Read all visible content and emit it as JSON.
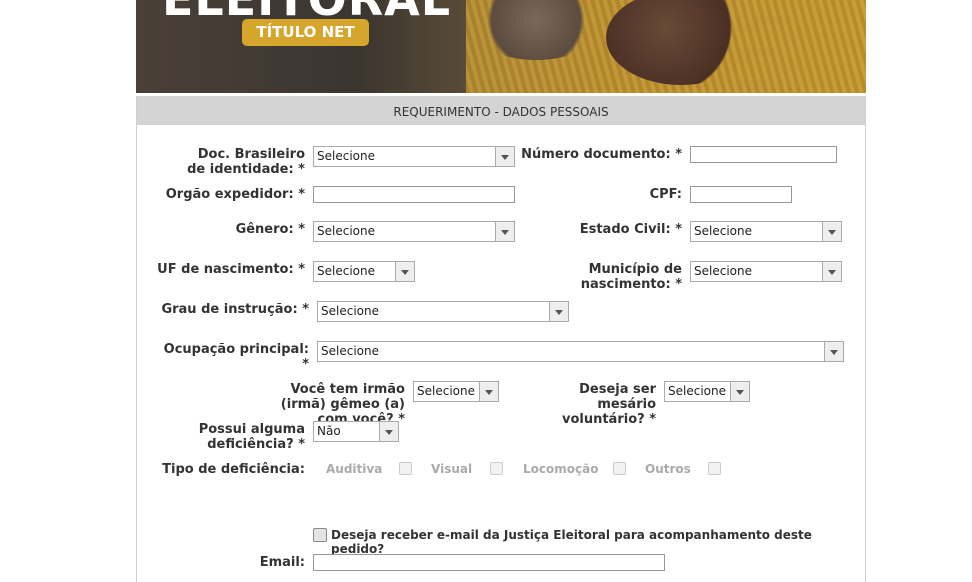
{
  "banner": {
    "title_text": "ELEITORAL",
    "badge": "TÍTULO NET"
  },
  "form": {
    "section_title": "REQUERIMENTO - DADOS PESSOAIS",
    "doc_label": "Doc. Brasileiro de identidade: *",
    "doc_value": "Selecione",
    "numero_label": "Número documento: *",
    "orgao_label": "Orgão expedidor: *",
    "cpf_label": "CPF:",
    "genero_label": "Gênero: *",
    "genero_value": "Selecione",
    "estado_label": "Estado Civil: *",
    "estado_value": "Selecione",
    "uf_label": "UF de nascimento: *",
    "uf_value": "Selecione",
    "municipio_label": "Município de nascimento: *",
    "municipio_value": "Selecione",
    "grau_label": "Grau de instrução: *",
    "grau_value": "Selecione",
    "ocupacao_label": "Ocupação principal: *",
    "ocupacao_value": "Selecione",
    "gemeo_label": "Você tem irmão (irmã) gêmeo (a) com você? *",
    "gemeo_value": "Selecione",
    "mesario_label": "Deseja ser mesário voluntário? *",
    "mesario_value": "Selecione",
    "deficiencia_label": "Possui alguma deficiência? *",
    "deficiencia_value": "Não",
    "tipo_label": "Tipo de deficiência:",
    "tipos": [
      "Auditiva",
      "Visual",
      "Locomoção",
      "Outros"
    ],
    "email_optin": "Deseja receber e-mail da Justiça Eleitoral para acompanhamento deste pedido?",
    "email_label": "Email:"
  }
}
